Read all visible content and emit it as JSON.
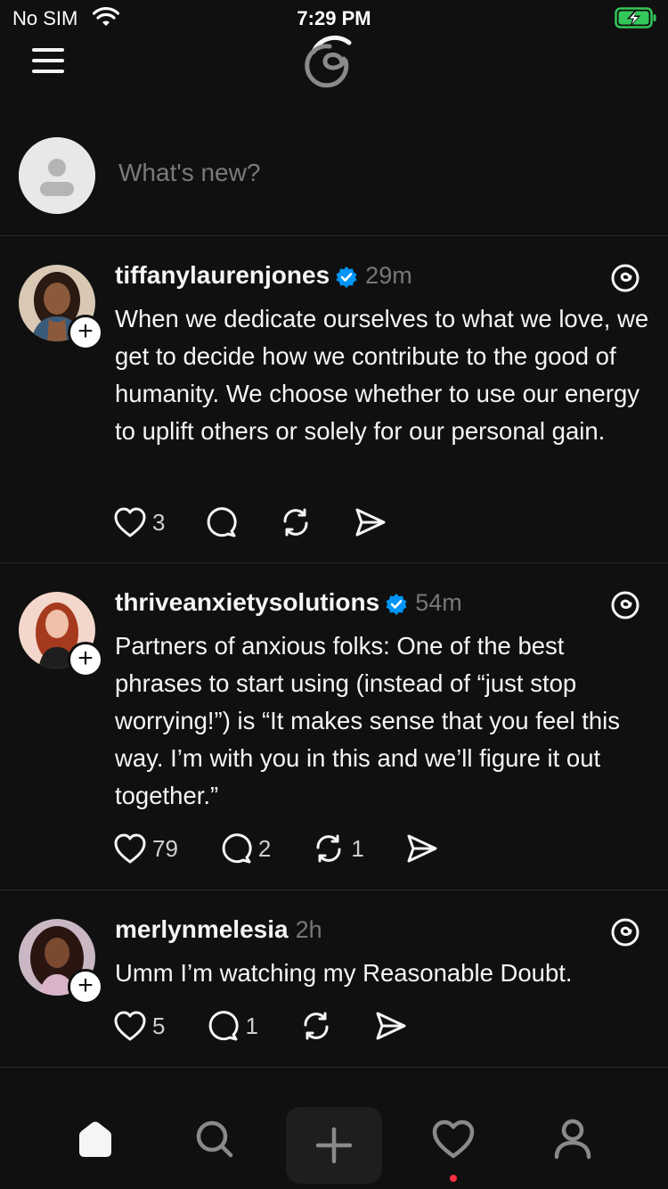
{
  "status_bar": {
    "carrier": "No SIM",
    "time": "7:29 PM",
    "battery_color": "#34c759"
  },
  "composer": {
    "placeholder": "What's new?"
  },
  "posts": [
    {
      "username": "tiffanylaurenjones",
      "verified": true,
      "time": "29m",
      "text": "When we dedicate ourselves to what we love, we get to decide how we contribute to the good of humanity. We choose whether to use our energy to uplift others or solely for our personal gain.",
      "likes": "3",
      "replies": "",
      "reposts": ""
    },
    {
      "username": "thriveanxietysolutions",
      "verified": true,
      "time": "54m",
      "text": "Partners of anxious folks: One of the best phrases to start using (instead of “just stop worrying!”) is “It makes sense that you feel this way. I’m with you in this and we’ll figure it out together.”",
      "likes": "79",
      "replies": "2",
      "reposts": "1"
    },
    {
      "username": "merlynmelesia",
      "verified": false,
      "time": "2h",
      "text": "Umm I’m watching my Reasonable Doubt.",
      "likes": "5",
      "replies": "1",
      "reposts": ""
    }
  ],
  "tab_bar": {
    "tabs": [
      "home-icon",
      "search-icon",
      "plus-icon",
      "heart-icon",
      "person-icon"
    ],
    "notification_dot_color": "#ff3040"
  },
  "colors": {
    "background": "#101010",
    "verified": "#0095f6",
    "divider": "#2a2a2a"
  }
}
